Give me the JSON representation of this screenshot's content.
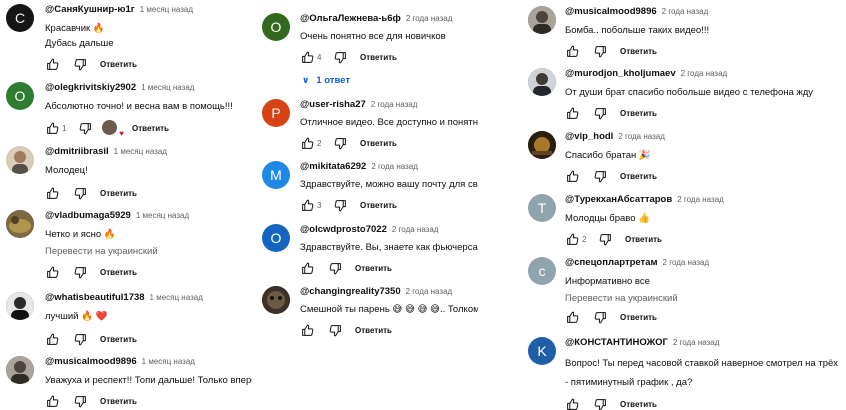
{
  "columns": [
    {
      "comments": [
        {
          "author": "@СаняКушнир-ю1г",
          "time": "1 месяц назад",
          "text": "Красавчик 🔥",
          "translate": "",
          "text2": "Дубась дальше",
          "likes": "",
          "heart": false,
          "avatar_letter": "С",
          "avatar_color": "#1a1a1a"
        },
        {
          "author": "@olegkrivitskiy2902",
          "time": "1 месяц назад",
          "text": "Абсолютно точно! и весна вам в помощь!!!",
          "likes": "1",
          "heart": true,
          "avatar_letter": "O",
          "avatar_color": "#2e7d32"
        },
        {
          "author": "@dmitriibrasil",
          "time": "1 месяц назад",
          "text": "Молодец!",
          "likes": "",
          "heart": false,
          "avatar_letter": "",
          "avatar_color": "#b8a48a"
        },
        {
          "author": "@vladbumaga5929",
          "time": "1 месяц назад",
          "text": "Четко и ясно 🔥",
          "translate": "Перевести на украинский",
          "likes": "",
          "heart": false,
          "avatar_letter": "",
          "avatar_color": "#8a6b3a"
        },
        {
          "author": "@whatisbeautiful1738",
          "time": "1 месяц назад",
          "text": "лучший 🔥 ❤️",
          "likes": "",
          "heart": false,
          "avatar_letter": "",
          "avatar_color": "#3b3b3b"
        },
        {
          "author": "@musicalmood9896",
          "time": "1 месяц назад",
          "text": "Уважуха и респект!! Топи дальше! Только впере",
          "likes": "",
          "heart": false,
          "avatar_letter": "",
          "avatar_color": "#5d5a55"
        }
      ]
    },
    {
      "comments": [
        {
          "author": "@ОльгаЛежнева-ь6ф",
          "time": "2 года назад",
          "text": "Очень понятно все для новичков",
          "likes": "4",
          "replies": "1 ответ",
          "avatar_letter": "О",
          "avatar_color": "#33691e"
        },
        {
          "author": "@user-risha27",
          "time": "2 года назад",
          "text": "Отличное видео. Все доступно и понятно",
          "likes": "2",
          "avatar_letter": "P",
          "avatar_color": "#d84315"
        },
        {
          "author": "@mikitata6292",
          "time": "2 года назад",
          "text": "Здравствуйте, можно вашу почту для связи?",
          "likes": "3",
          "avatar_letter": "M",
          "avatar_color": "#1e88e5"
        },
        {
          "author": "@olcwdprosto7022",
          "time": "2 года назад",
          "text": "Здравствуйте. Вы, знаете как фьючерсах поста",
          "likes": "",
          "avatar_letter": "O",
          "avatar_color": "#1565c0"
        },
        {
          "author": "@changingreality7350",
          "time": "2 года назад",
          "text": "Смешной ты парень 😅 😅 😅 😅.. Толком ниче",
          "likes": "",
          "avatar_letter": "",
          "avatar_color": "#4a3b2a"
        }
      ]
    },
    {
      "comments": [
        {
          "author": "@musicalmood9896",
          "time": "2 года назад",
          "text": "Бомба.. побольше таких видео!!!",
          "likes": "",
          "avatar_letter": "",
          "avatar_color": "#5d5a55"
        },
        {
          "author": "@murodjon_kholjumaev",
          "time": "2 года назад",
          "text": "От души брат спасибо  побольше видео с телефона жду",
          "likes": "",
          "avatar_letter": "",
          "avatar_color": "#6b7078"
        },
        {
          "author": "@vip_hodl",
          "time": "2 года назад",
          "text": "Спасибо братан 🎉",
          "likes": "",
          "avatar_letter": "",
          "avatar_color": "#3a2a18"
        },
        {
          "author": "@ТурекханАбсаттаров",
          "time": "2 года назад",
          "text": "Молодцы браво 👍",
          "likes": "2",
          "avatar_letter": "Т",
          "avatar_color": "#90a4ae"
        },
        {
          "author": "@спецоплартретам",
          "time": "2 года назад",
          "text": "Информативно все",
          "translate": "Перевести на украинский",
          "likes": "",
          "avatar_letter": "c",
          "avatar_color": "#90a4ae"
        },
        {
          "author": "@КОНСТАНТИНОЖОГ",
          "time": "2 года назад",
          "text": "Вопрос! Ты перед часовой ставкой наверное смотрел на трёх - пятиминутный график , да?",
          "likes": "",
          "avatar_letter": "K",
          "avatar_color": "#1e5fa8"
        }
      ]
    }
  ],
  "labels": {
    "reply": "Ответить"
  }
}
